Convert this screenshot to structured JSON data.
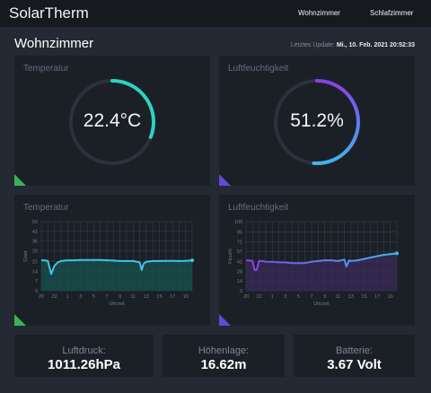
{
  "app": {
    "title": "SolarTherm",
    "nav": [
      "Wohnzimmer",
      "Schlafzimmer"
    ]
  },
  "room": {
    "title": "Wohnzimmer",
    "update_label": "Letztes Update:",
    "update_value": "Mi., 10. Feb. 2021 20:52:33"
  },
  "gauges": [
    {
      "title": "Temperatur",
      "value_text": "22.4°C",
      "fraction": 0.31,
      "color_start": "#2fd1c0",
      "color_end": "#2fd1c0",
      "corner_color": "#36b35a"
    },
    {
      "title": "Luftfeuchtigkeit",
      "value_text": "51.2%",
      "fraction": 0.512,
      "color_start": "#8a3ee8",
      "color_end": "#3fb6f0",
      "corner_color": "#6348d8"
    }
  ],
  "charts_titles": [
    "Temperatur",
    "Luftfeuchtigkeit"
  ],
  "chart_data": [
    {
      "type": "line",
      "title": "",
      "xlabel": "Uhrzeit",
      "ylabel": "Grad",
      "ylim": [
        0,
        50
      ],
      "yticks": [
        0,
        7,
        14,
        21,
        29,
        36,
        43,
        50
      ],
      "xticks": [
        "20",
        "21",
        "22",
        "0",
        "1",
        "2",
        "3",
        "4",
        "5",
        "6",
        "7",
        "8",
        "9",
        "10",
        "11",
        "12",
        "13",
        "14",
        "15",
        "16",
        "17",
        "18",
        "19",
        "20"
      ],
      "series": [
        {
          "color": "#3fc4ea",
          "fill": "#16524f",
          "x": [
            0,
            0.5,
            1,
            1.5,
            2,
            2.5,
            3,
            4,
            5,
            6,
            7,
            8,
            9,
            10,
            11,
            12,
            13,
            14,
            15,
            15.3,
            15.6,
            16,
            17,
            18,
            19,
            20,
            21,
            22,
            23
          ],
          "y": [
            22,
            22,
            21.5,
            12,
            18,
            20.5,
            21.5,
            22,
            22,
            22.2,
            22.3,
            22.3,
            22.3,
            22,
            21.8,
            21.5,
            21.5,
            21.5,
            20.5,
            15,
            19.5,
            21,
            21.5,
            21.5,
            21.6,
            21.6,
            21.5,
            21.6,
            22
          ]
        }
      ],
      "grid": true
    },
    {
      "type": "line",
      "title": "",
      "xlabel": "Uhrzeit",
      "ylabel": "Feucht",
      "ylim": [
        0,
        100
      ],
      "yticks": [
        0,
        14,
        28,
        42,
        57,
        71,
        85,
        100
      ],
      "xticks": [
        "20",
        "21",
        "22",
        "0",
        "1",
        "2",
        "3",
        "4",
        "5",
        "6",
        "7",
        "8",
        "9",
        "10",
        "11",
        "12",
        "13",
        "14",
        "15",
        "16",
        "17",
        "18",
        "19",
        "20"
      ],
      "series": [
        {
          "color_start": "#8a3ee8",
          "color_end": "#3fb6f0",
          "fill": "#3a2a5a",
          "x": [
            0,
            0.5,
            1,
            1.3,
            1.6,
            2,
            2.5,
            3,
            4,
            5,
            6,
            7,
            8,
            9,
            10,
            11,
            12,
            13,
            14,
            15,
            15.3,
            15.7,
            16,
            17,
            18,
            19,
            20,
            21,
            22,
            23
          ],
          "y": [
            44,
            44,
            43,
            30,
            30,
            43,
            43,
            42,
            42,
            41,
            41,
            40,
            40,
            40,
            42,
            43,
            44,
            44,
            43,
            45,
            35,
            44,
            43,
            44,
            46,
            48,
            50,
            52,
            53,
            54
          ]
        }
      ],
      "grid": true
    }
  ],
  "stats": [
    {
      "label": "Luftdruck:",
      "value": "1011.26hPa"
    },
    {
      "label": "Höhenlage:",
      "value": "16.62m"
    },
    {
      "label": "Batterie:",
      "value": "3.67 Volt"
    }
  ]
}
